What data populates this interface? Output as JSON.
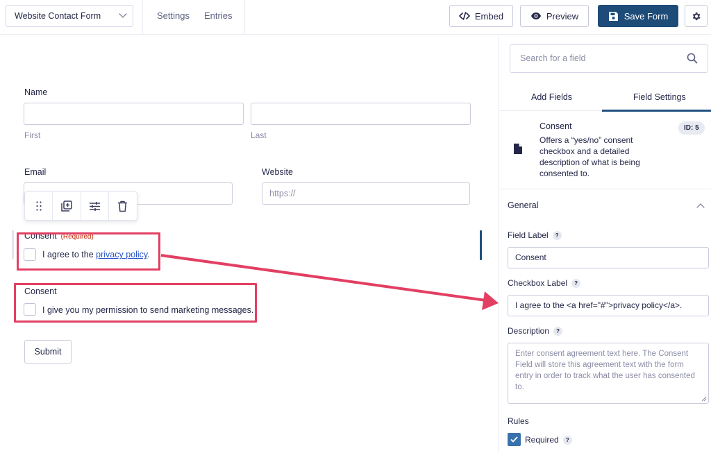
{
  "header": {
    "form_name": "Website Contact Form",
    "settings_label": "Settings",
    "entries_label": "Entries",
    "embed_label": "Embed",
    "preview_label": "Preview",
    "save_label": "Save Form"
  },
  "form": {
    "name_label": "Name",
    "first_sublabel": "First",
    "last_sublabel": "Last",
    "email_label": "Email",
    "website_label": "Website",
    "website_placeholder": "https://",
    "consent1_label": "Consent",
    "consent1_required": "(Required)",
    "consent1_text_before": "I agree to the ",
    "consent1_link": "privacy policy",
    "consent1_text_after": ".",
    "consent2_label": "Consent",
    "consent2_text": "I give you my permission to send marketing messages.",
    "submit_label": "Submit"
  },
  "sidebar": {
    "search_placeholder": "Search for a field",
    "tab_add_fields": "Add Fields",
    "tab_field_settings": "Field Settings",
    "field_title": "Consent",
    "field_description": "Offers a “yes/no” consent checkbox and a detailed description of what is being consented to.",
    "field_id": "ID: 5",
    "section_general": "General",
    "field_label_label": "Field Label",
    "field_label_value": "Consent",
    "checkbox_label_label": "Checkbox Label",
    "checkbox_label_value": "I agree to the <a href=\"#\">privacy policy</a>.",
    "description_label": "Description",
    "description_placeholder": "Enter consent agreement text here.  The Consent Field will store this agreement text with the form entry in order to track what the user has consented to.",
    "rules_label": "Rules",
    "required_label": "Required",
    "help_glyph": "?"
  },
  "colors": {
    "primary": "#1e4c78",
    "highlight": "#e23f63",
    "link": "#2754c5",
    "checkbox_checked": "#3872ad"
  }
}
